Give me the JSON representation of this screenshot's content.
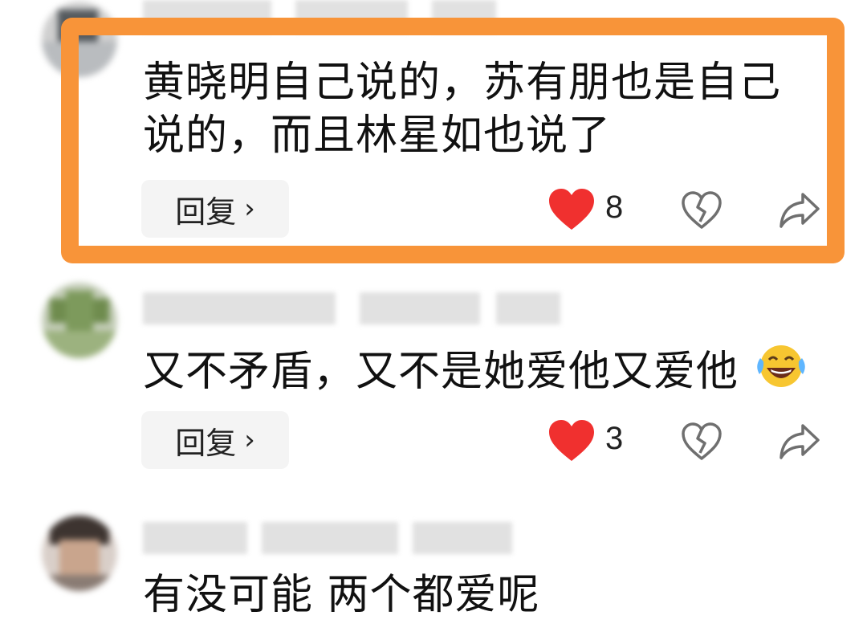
{
  "comments": [
    {
      "text_lines": [
        "黄晓明自己说的，苏有朋也是自己",
        "说的，而且林星如也说了"
      ],
      "reply_label": "回复",
      "likes": "8",
      "highlighted": true
    },
    {
      "text_lines": [
        "又不矛盾，又不是她爱他又爱他"
      ],
      "emoji": "laughing-with-tears",
      "reply_label": "回复",
      "likes": "3",
      "highlighted": false
    },
    {
      "text_lines": [
        "有没可能 两个都爱呢"
      ],
      "highlighted": false
    }
  ],
  "colors": {
    "highlight": "#f89439",
    "like_heart": "#f0302f",
    "outline_icon": "#6f6f6f"
  },
  "icons": [
    "heart-filled-icon",
    "broken-heart-icon",
    "share-arrow-icon",
    "chevron-right-icon"
  ]
}
